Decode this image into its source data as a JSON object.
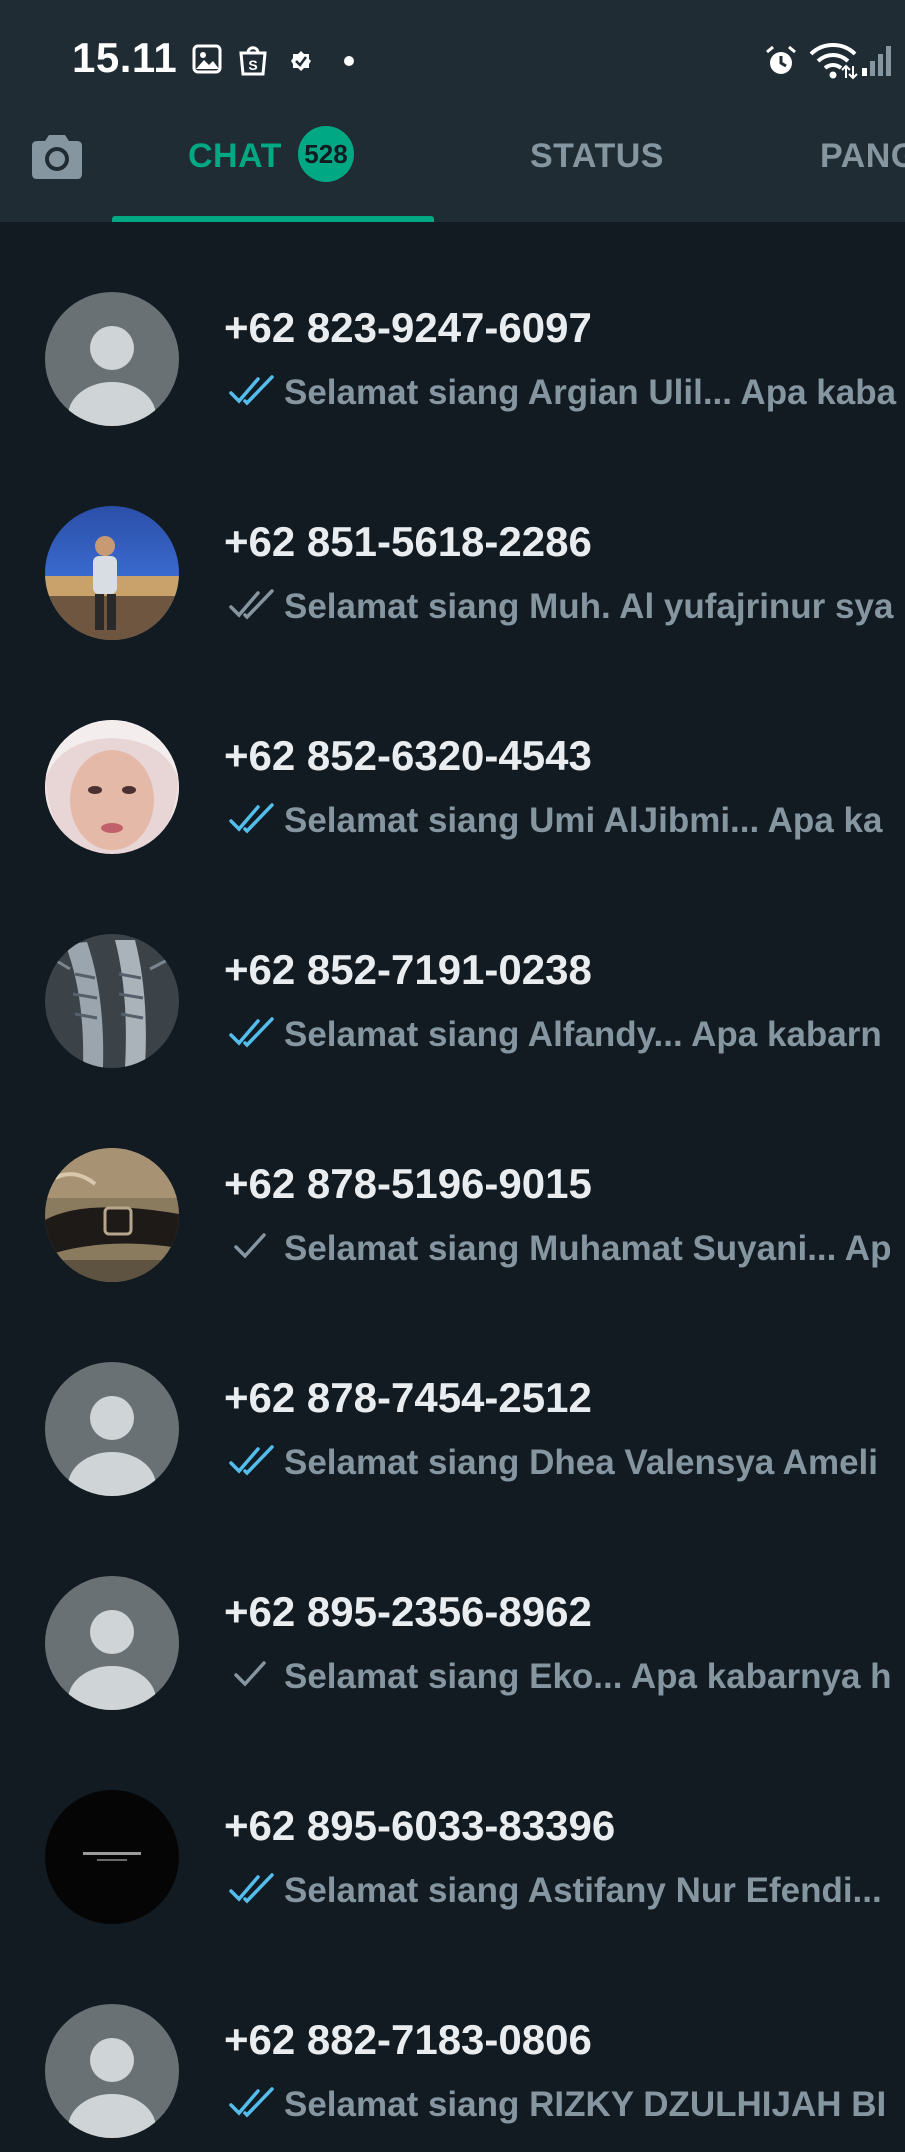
{
  "status_bar": {
    "time": "15.11",
    "left_icons": [
      "gallery-icon",
      "shopee-icon",
      "verified-icon",
      "dot-icon"
    ],
    "right_icons": [
      "alarm-icon",
      "wifi-icon",
      "signal-icon"
    ]
  },
  "tabs": {
    "camera_icon": "camera-icon",
    "chat_label": "CHAT",
    "chat_badge": "528",
    "status_label": "STATUS",
    "calls_label": "PANG",
    "active": "chat"
  },
  "colors": {
    "accent": "#00a884",
    "read_tick": "#53bdeb",
    "unread_tick": "#8696a0",
    "background": "#121b22",
    "header": "#202c33"
  },
  "chats": [
    {
      "name": "+62 823-9247-6097",
      "tick": "double-read",
      "preview": "Selamat siang  Argian Ulil... Apa kaba",
      "avatar": "default"
    },
    {
      "name": "+62 851-5618-2286",
      "tick": "double-delivered",
      "preview": "Selamat siang  Muh. Al yufajrinur sya",
      "avatar": "photo-man"
    },
    {
      "name": "+62 852-6320-4543",
      "tick": "double-read",
      "preview": "Selamat siang  Umi AlJibmi... Apa ka",
      "avatar": "photo-woman"
    },
    {
      "name": "+62 852-7191-0238",
      "tick": "double-read",
      "preview": "Selamat siang  Alfandy... Apa kabarn",
      "avatar": "photo-lobster"
    },
    {
      "name": "+62 878-5196-9015",
      "tick": "single",
      "preview": "Selamat siang  Muhamat Suyani... Ap",
      "avatar": "photo-belt"
    },
    {
      "name": "+62 878-7454-2512",
      "tick": "double-read",
      "preview": "Selamat siang  Dhea Valensya Ameli",
      "avatar": "default"
    },
    {
      "name": "+62 895-2356-8962",
      "tick": "single",
      "preview": "Selamat siang  Eko... Apa kabarnya h",
      "avatar": "default"
    },
    {
      "name": "+62 895-6033-83396",
      "tick": "double-read",
      "preview": "Selamat siang  Astifany Nur Efendi...",
      "avatar": "photo-black"
    },
    {
      "name": "+62 882-7183-0806",
      "tick": "double-read",
      "preview": "Selamat siang  RIZKY DZULHIJAH BI",
      "avatar": "default"
    }
  ]
}
